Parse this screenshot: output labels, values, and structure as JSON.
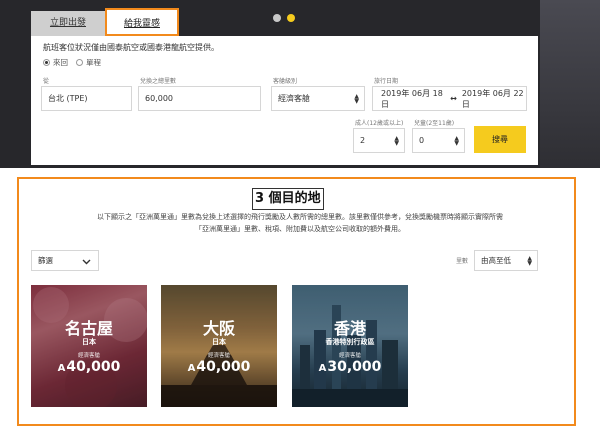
{
  "tabs": {
    "flights": "立即出發",
    "redeem": "給我靈感"
  },
  "booking": {
    "notice": "航班客位狀況僅由國泰航空或國泰港龍航空提供。",
    "trip_round": "來回",
    "trip_oneway": "單程",
    "from_label": "從",
    "from_value": "台北 (TPE)",
    "miles_label": "兌換之總里數",
    "miles_value": "60,000",
    "cabin_label": "客艙級別",
    "cabin_value": "經濟客艙",
    "dates_label": "旅行日期",
    "date_from": "2019年 06月 18日",
    "date_arrow": "↔",
    "date_to": "2019年 06月 22日",
    "adults_label": "成人(12歲或以上)",
    "adults_value": "2",
    "children_label": "兒童(2至11歲)",
    "children_value": "0",
    "search": "搜尋"
  },
  "results": {
    "title": "3 個目的地",
    "desc_line1": "以下顯示之「亞洲萬里通」里數為兌換上述選擇的飛行獎勵及人數所需的總里數。該里數僅供參考，兌換獎勵機票時將顯示實際所需",
    "desc_line2": "「亞洲萬里通」里數、稅項、附加費以及航空公司收取的額外費用。",
    "filter": "篩選",
    "sort_label": "里數",
    "sort_value": "由高至低"
  },
  "cards": [
    {
      "city": "名古屋",
      "country": "日本",
      "cabin": "經濟客艙",
      "miles": "40,000"
    },
    {
      "city": "大阪",
      "country": "日本",
      "cabin": "經濟客艙",
      "miles": "40,000"
    },
    {
      "city": "香港",
      "country": "香港特別行政區",
      "cabin": "經濟客艙",
      "miles": "30,000"
    }
  ],
  "icons": {
    "asia_miles": "A",
    "chevron": "chevron-down-icon",
    "updown": "updown-arrow-icon"
  },
  "colors": {
    "accent_orange": "#f28a1c",
    "button_yellow": "#f5cb1e",
    "dot_active": "#f5cb1e"
  }
}
